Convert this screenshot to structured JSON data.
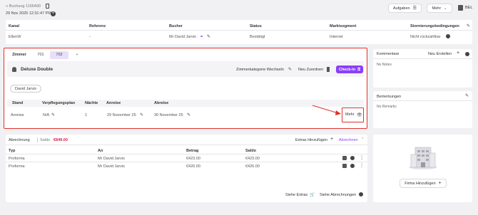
{
  "header": {
    "back_link": "< Buchung 1165400",
    "datetime": "29 Nov 2025 12:31:47 PM",
    "tasks_button": "Aufgaben",
    "more_button": "Mehr",
    "print_label": "BEL"
  },
  "booking": {
    "columns": [
      "Kanal",
      "Referenz",
      "Bucher",
      "Status",
      "Marktsegment",
      "Stornierungsbedingungen"
    ],
    "values": [
      "EllenW",
      "-",
      "Mr David Jarvis",
      "Bestätigt",
      "Internet",
      "Nicht rückzahlbar"
    ]
  },
  "rooms": {
    "tabs": [
      "Zimmer",
      "701",
      "702",
      "+"
    ],
    "room_type": "Deluxe Double",
    "change_category": "Zimmerkategorie Wechseln",
    "reassign": "Neu Zuordnen",
    "checkin": "Check-In",
    "guest_chip": "David Jarvis",
    "columns": [
      "Stand",
      "Verpflegungsplan",
      "Nächte",
      "Anreise",
      "Abreise"
    ],
    "row": [
      "Anreise",
      "N/A",
      "1",
      "29 November 25",
      "30 November 25"
    ],
    "more": "Mehr"
  },
  "billing": {
    "title": "Abrechnung",
    "saldo_label": "Saldo",
    "saldo_value": "€849.00",
    "add_extras": "Extras Hinzufügen",
    "bills": "Abrechnen",
    "columns": [
      "Typ",
      "An",
      "Betrag",
      "Saldo"
    ],
    "rows": [
      [
        "Proforma",
        "Mr David Jarvis",
        "€423.00",
        "€423.00"
      ],
      [
        "Proforma",
        "Mr David Jarvis",
        "€426.00",
        "€426.00"
      ]
    ],
    "see_extras": "Siehe Extras",
    "see_bills": "Siehe Abrechnungen"
  },
  "comments": {
    "title": "Kommentare",
    "new": "Neu Erstellen",
    "empty": "No Notes"
  },
  "remarks": {
    "title": "Bemerkungen",
    "empty": "No Remarks"
  },
  "company": {
    "add": "Firma Hinzufügen"
  },
  "colors": {
    "accent": "#8a3ffc",
    "highlight": "#e0312a",
    "saldo": "#d6204a",
    "active_tab": "#e8e0f8"
  }
}
